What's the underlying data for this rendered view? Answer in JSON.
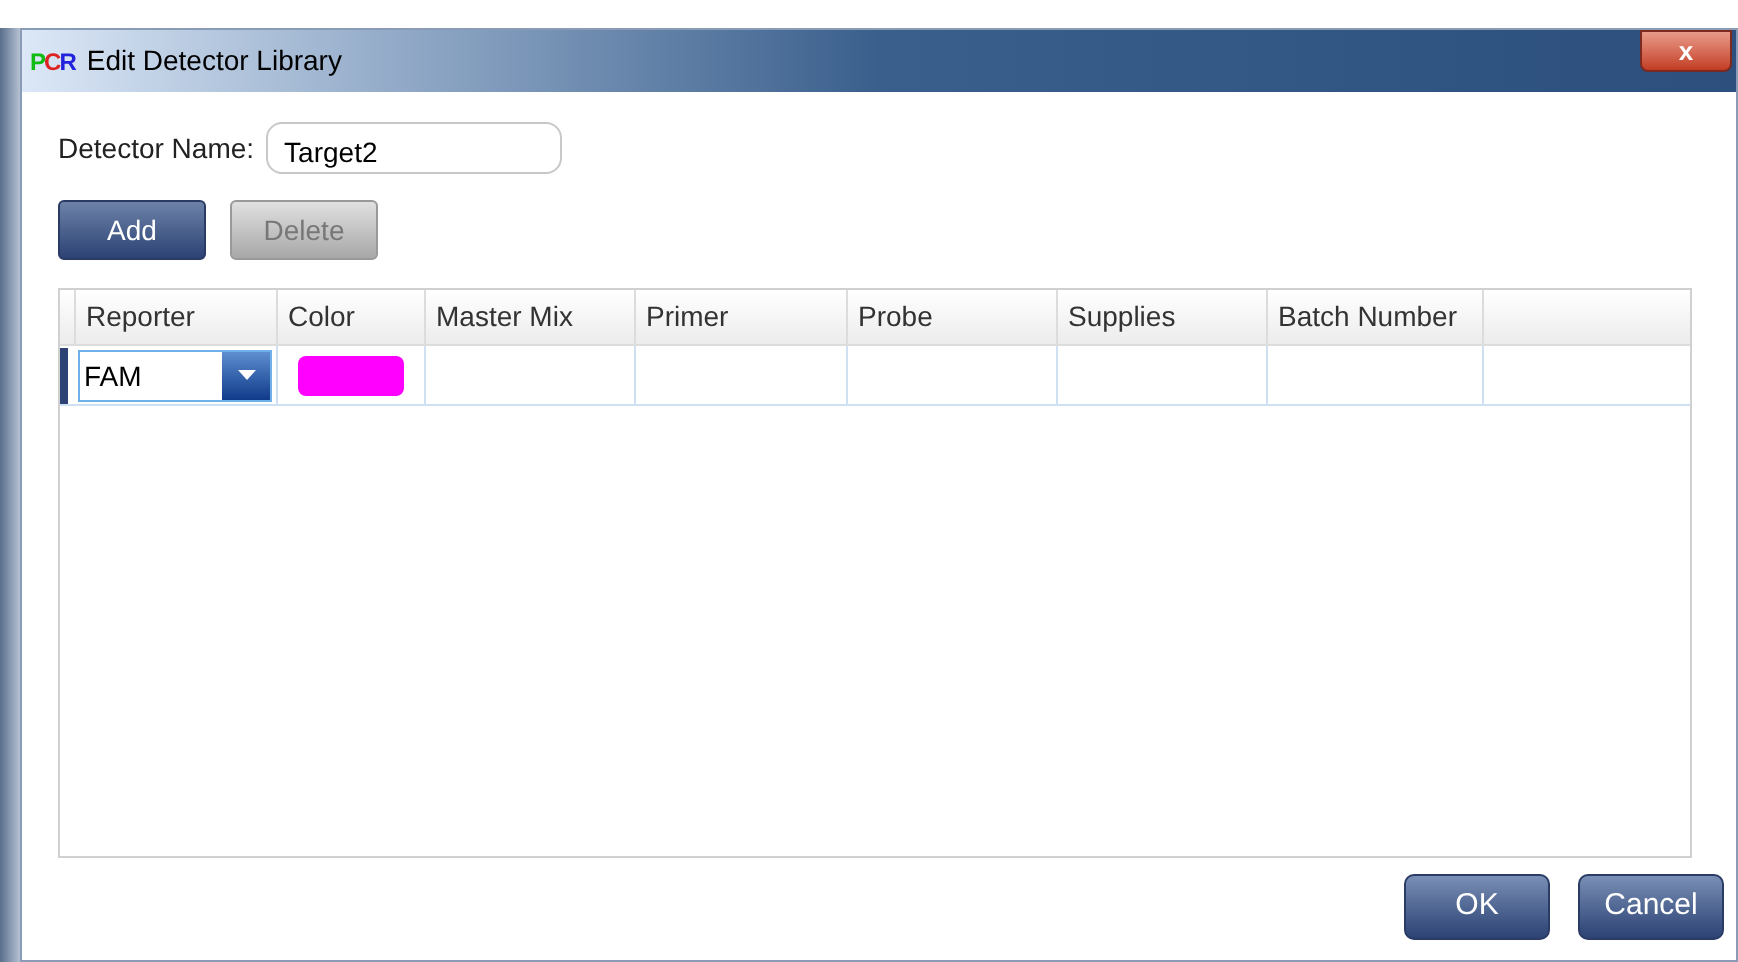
{
  "window": {
    "logo": "PCR",
    "title": "Edit Detector Library",
    "close": "x"
  },
  "detector_name": {
    "label": "Detector Name:",
    "value": "Target2"
  },
  "buttons": [
    {
      "label": "Add",
      "disabled": false
    },
    {
      "label": "Delete",
      "disabled": true
    }
  ],
  "table": {
    "columns": [
      "Reporter",
      "Color",
      "Master Mix",
      "Primer",
      "Probe",
      "Supplies",
      "Batch Number"
    ],
    "rows": [
      {
        "reporter": "FAM",
        "color": "#ff00ff"
      }
    ]
  },
  "footer_buttons": [
    "OK",
    "Cancel"
  ]
}
